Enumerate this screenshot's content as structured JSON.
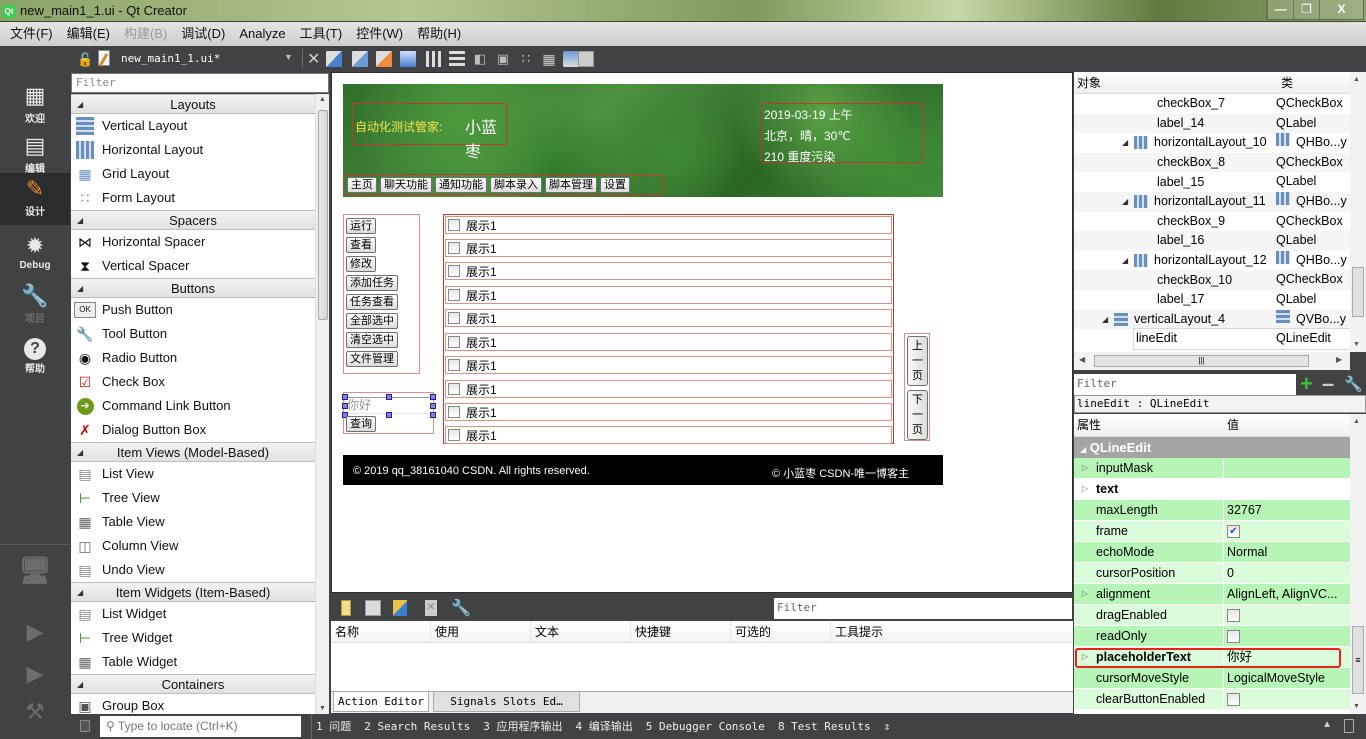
{
  "window": {
    "title": "new_main1_1.ui - Qt Creator",
    "controls": [
      "minimize",
      "restore",
      "close"
    ]
  },
  "menubar": {
    "items": [
      {
        "label": "文件(F)",
        "enabled": true
      },
      {
        "label": "编辑(E)",
        "enabled": true
      },
      {
        "label": "构建(B)",
        "enabled": false
      },
      {
        "label": "调试(D)",
        "enabled": true
      },
      {
        "label": "Analyze",
        "enabled": true
      },
      {
        "label": "工具(T)",
        "enabled": true
      },
      {
        "label": "控件(W)",
        "enabled": true
      },
      {
        "label": "帮助(H)",
        "enabled": true
      }
    ]
  },
  "modebar": {
    "modes": [
      {
        "label": "欢迎",
        "icon": "grid-icon"
      },
      {
        "label": "编辑",
        "icon": "document-icon"
      },
      {
        "label": "设计",
        "icon": "pencil-icon",
        "active": true
      },
      {
        "label": "Debug",
        "icon": "bug-icon"
      },
      {
        "label": "项目",
        "icon": "wrench-icon",
        "disabled": true
      },
      {
        "label": "帮助",
        "icon": "help-icon"
      }
    ],
    "actions": [
      "kit-selector-monitor-icon",
      "run-icon",
      "debug-run-icon",
      "build-hammer-icon"
    ]
  },
  "editor_toolbar": {
    "filename": "new_main1_1.ui*",
    "tools": [
      "edit-widgets",
      "edit-signals-slots",
      "edit-buddies",
      "edit-tab-order",
      "lay-out-horizontally",
      "lay-out-vertically",
      "lay-out-horizontal-splitter",
      "lay-out-vertical-splitter",
      "lay-out-form",
      "lay-out-grid",
      "break-layout",
      "adjust-size"
    ]
  },
  "widgetbox": {
    "filter_placeholder": "Filter",
    "categories": [
      {
        "name": "Layouts",
        "items": [
          "Vertical Layout",
          "Horizontal Layout",
          "Grid Layout",
          "Form Layout"
        ]
      },
      {
        "name": "Spacers",
        "items": [
          "Horizontal Spacer",
          "Vertical Spacer"
        ]
      },
      {
        "name": "Buttons",
        "items": [
          "Push Button",
          "Tool Button",
          "Radio Button",
          "Check Box",
          "Command Link Button",
          "Dialog Button Box"
        ]
      },
      {
        "name": "Item Views (Model-Based)",
        "items": [
          "List View",
          "Tree View",
          "Table View",
          "Column View",
          "Undo View"
        ]
      },
      {
        "name": "Item Widgets (Item-Based)",
        "items": [
          "List Widget",
          "Tree Widget",
          "Table Widget"
        ]
      },
      {
        "name": "Containers",
        "items": [
          "Group Box"
        ]
      }
    ]
  },
  "form": {
    "header": {
      "app_label": "自动化测试管家:",
      "user_name": "小蓝枣",
      "date": "2019-03-19 上午",
      "weather": "北京，晴，30℃",
      "air": "210 重度污染"
    },
    "nav_buttons": [
      "主页",
      "聊天功能",
      "通知功能",
      "脚本录入",
      "脚本管理",
      "设置"
    ],
    "side_buttons": [
      "运行",
      "查看",
      "修改",
      "添加任务",
      "任务查看",
      "全部选中",
      "清空选中",
      "文件管理"
    ],
    "search": {
      "placeholder": "你好",
      "button": "查询"
    },
    "list_items": [
      "展示1",
      "展示1",
      "展示1",
      "展示1",
      "展示1",
      "展示1",
      "展示1",
      "展示1",
      "展示1",
      "展示1"
    ],
    "pager": {
      "prev": "上一页",
      "next": "下一页"
    },
    "footer": {
      "left": "© 2019 qq_38161040 CSDN. All rights reserved.",
      "right": "© 小蓝枣 CSDN-唯一博客主"
    }
  },
  "action_editor": {
    "filter_placeholder": "Filter",
    "columns": [
      "名称",
      "使用",
      "文本",
      "快捷键",
      "可选的",
      "工具提示"
    ],
    "tabs": [
      {
        "label": "Action Editor",
        "active": true
      },
      {
        "label": "Signals  Slots Ed…",
        "active": false
      }
    ]
  },
  "statusbar": {
    "locator_placeholder": "Type to locate (Ctrl+K)",
    "outputs": [
      "1 问题",
      "2 Search Results",
      "3 应用程序输出",
      "4 编译输出",
      "5 Debugger Console",
      "8 Test Results"
    ]
  },
  "object_inspector": {
    "columns": [
      "对象",
      "类"
    ],
    "rows": [
      {
        "name": "checkBox_7",
        "class": "QCheckBox",
        "level": 3
      },
      {
        "name": "label_14",
        "class": "QLabel",
        "level": 3
      },
      {
        "name": "horizontalLayout_10",
        "class": "QHBo...y",
        "level": 2,
        "layout": "h",
        "expanded": true
      },
      {
        "name": "checkBox_8",
        "class": "QCheckBox",
        "level": 3
      },
      {
        "name": "label_15",
        "class": "QLabel",
        "level": 3
      },
      {
        "name": "horizontalLayout_11",
        "class": "QHBo...y",
        "level": 2,
        "layout": "h",
        "expanded": true
      },
      {
        "name": "checkBox_9",
        "class": "QCheckBox",
        "level": 3
      },
      {
        "name": "label_16",
        "class": "QLabel",
        "level": 3
      },
      {
        "name": "horizontalLayout_12",
        "class": "QHBo...y",
        "level": 2,
        "layout": "h",
        "expanded": true
      },
      {
        "name": "checkBox_10",
        "class": "QCheckBox",
        "level": 3
      },
      {
        "name": "label_17",
        "class": "QLabel",
        "level": 3
      },
      {
        "name": "verticalLayout_4",
        "class": "QVBo...y",
        "level": 1,
        "layout": "v",
        "expanded": true
      },
      {
        "name": "lineEdit",
        "class": "QLineEdit",
        "level": 2,
        "selected": true
      }
    ]
  },
  "property_editor": {
    "filter_placeholder": "Filter",
    "object_label": "lineEdit : QLineEdit",
    "columns": [
      "属性",
      "值"
    ],
    "section": "QLineEdit",
    "properties": [
      {
        "name": "inputMask",
        "value": "",
        "expandable": true
      },
      {
        "name": "text",
        "value": "",
        "expandable": true,
        "bold": true
      },
      {
        "name": "maxLength",
        "value": "32767"
      },
      {
        "name": "frame",
        "value": "checked",
        "checkbox": true,
        "checked": true
      },
      {
        "name": "echoMode",
        "value": "Normal"
      },
      {
        "name": "cursorPosition",
        "value": "0"
      },
      {
        "name": "alignment",
        "value": "AlignLeft, AlignVC...",
        "expandable": true
      },
      {
        "name": "dragEnabled",
        "value": "unchecked",
        "checkbox": true,
        "checked": false
      },
      {
        "name": "readOnly",
        "value": "unchecked",
        "checkbox": true,
        "checked": false
      },
      {
        "name": "placeholderText",
        "value": "你好",
        "expandable": true,
        "bold": true,
        "highlighted": true
      },
      {
        "name": "cursorMoveStyle",
        "value": "LogicalMoveStyle"
      },
      {
        "name": "clearButtonEnabled",
        "value": "unchecked",
        "checkbox": true,
        "checked": false
      }
    ]
  },
  "colors": {
    "highlight_box": "#e8231e",
    "property_row_changed": "#b7f5b7",
    "property_row_alt": "#dafcda",
    "header_label": "#f7e24d",
    "layout_outline": "#c0392b"
  }
}
